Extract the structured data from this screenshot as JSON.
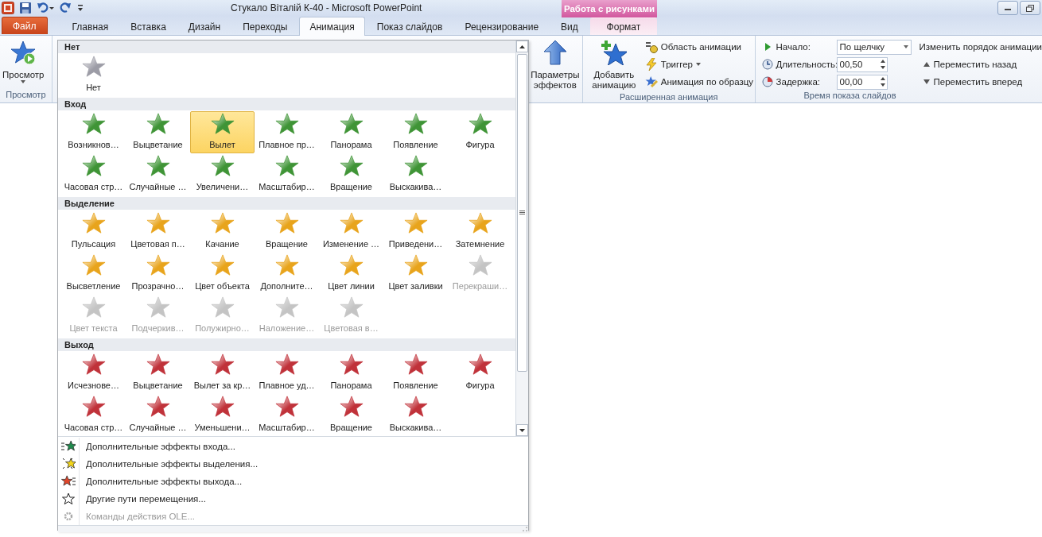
{
  "window": {
    "title": "Стукало Віталій К-40  -  Microsoft PowerPoint",
    "contextual_group": "Работа с рисунками"
  },
  "tabs": [
    {
      "label": "Файл",
      "kind": "file",
      "selected": false
    },
    {
      "label": "Главная",
      "kind": "normal",
      "selected": false
    },
    {
      "label": "Вставка",
      "kind": "normal",
      "selected": false
    },
    {
      "label": "Дизайн",
      "kind": "normal",
      "selected": false
    },
    {
      "label": "Переходы",
      "kind": "normal",
      "selected": false
    },
    {
      "label": "Анимация",
      "kind": "normal",
      "selected": true
    },
    {
      "label": "Показ слайдов",
      "kind": "normal",
      "selected": false
    },
    {
      "label": "Рецензирование",
      "kind": "normal",
      "selected": false
    },
    {
      "label": "Вид",
      "kind": "normal",
      "selected": false
    },
    {
      "label": "Формат",
      "kind": "contextual",
      "selected": false
    }
  ],
  "preview": {
    "button": "Просмотр",
    "group": "Просмотр"
  },
  "effect_options": {
    "label": "Параметры эффектов"
  },
  "advanced": {
    "add": "Добавить анимацию",
    "group": "Расширенная анимация",
    "items": [
      {
        "kind": "pane",
        "label": "Область анимации"
      },
      {
        "kind": "trigger",
        "label": "Триггер"
      },
      {
        "kind": "painter",
        "label": "Анимация по образцу"
      }
    ]
  },
  "timing": {
    "start_label": "Начало:",
    "start_value": "По щелчку",
    "duration_label": "Длительность:",
    "duration_value": "00,50",
    "delay_label": "Задержка:",
    "delay_value": "00,00",
    "reorder_title": "Изменить порядок анимации",
    "move_back": "Переместить назад",
    "move_forward": "Переместить вперед",
    "group": "Время показа слайдов"
  },
  "gallery": {
    "sections": [
      {
        "title": "Нет",
        "color": "#9c9ca6",
        "items": [
          {
            "label": "Нет",
            "selected": false,
            "disabled": false
          }
        ]
      },
      {
        "title": "Вход",
        "color": "#3f9436",
        "items": [
          {
            "label": "Возникнов…",
            "selected": false,
            "disabled": false
          },
          {
            "label": "Выцветание",
            "selected": false,
            "disabled": false
          },
          {
            "label": "Вылет",
            "selected": true,
            "disabled": false
          },
          {
            "label": "Плавное пр…",
            "selected": false,
            "disabled": false
          },
          {
            "label": "Панорама",
            "selected": false,
            "disabled": false
          },
          {
            "label": "Появление",
            "selected": false,
            "disabled": false
          },
          {
            "label": "Фигура",
            "selected": false,
            "disabled": false
          },
          {
            "label": "Часовая стр…",
            "selected": false,
            "disabled": false
          },
          {
            "label": "Случайные …",
            "selected": false,
            "disabled": false
          },
          {
            "label": "Увеличени…",
            "selected": false,
            "disabled": false
          },
          {
            "label": "Масштабир…",
            "selected": false,
            "disabled": false
          },
          {
            "label": "Вращение",
            "selected": false,
            "disabled": false
          },
          {
            "label": "Выскакива…",
            "selected": false,
            "disabled": false
          }
        ]
      },
      {
        "title": "Выделение",
        "color": "#e8a41c",
        "items": [
          {
            "label": "Пульсация",
            "selected": false,
            "disabled": false
          },
          {
            "label": "Цветовая п…",
            "selected": false,
            "disabled": false
          },
          {
            "label": "Качание",
            "selected": false,
            "disabled": false
          },
          {
            "label": "Вращение",
            "selected": false,
            "disabled": false
          },
          {
            "label": "Изменение …",
            "selected": false,
            "disabled": false
          },
          {
            "label": "Приведени…",
            "selected": false,
            "disabled": false
          },
          {
            "label": "Затемнение",
            "selected": false,
            "disabled": false
          },
          {
            "label": "Высветление",
            "selected": false,
            "disabled": false
          },
          {
            "label": "Прозрачно…",
            "selected": false,
            "disabled": false
          },
          {
            "label": "Цвет объекта",
            "selected": false,
            "disabled": false
          },
          {
            "label": "Дополните…",
            "selected": false,
            "disabled": false
          },
          {
            "label": "Цвет линии",
            "selected": false,
            "disabled": false
          },
          {
            "label": "Цвет заливки",
            "selected": false,
            "disabled": false
          },
          {
            "label": "Перекраши…",
            "selected": false,
            "disabled": true
          },
          {
            "label": "Цвет текста",
            "selected": false,
            "disabled": true
          },
          {
            "label": "Подчеркив…",
            "selected": false,
            "disabled": true
          },
          {
            "label": "Полужирно…",
            "selected": false,
            "disabled": true
          },
          {
            "label": "Наложение…",
            "selected": false,
            "disabled": true
          },
          {
            "label": "Цветовая в…",
            "selected": false,
            "disabled": true
          }
        ]
      },
      {
        "title": "Выход",
        "color": "#c0323a",
        "items": [
          {
            "label": "Исчезнове…",
            "selected": false,
            "disabled": false
          },
          {
            "label": "Выцветание",
            "selected": false,
            "disabled": false
          },
          {
            "label": "Вылет за кр…",
            "selected": false,
            "disabled": false
          },
          {
            "label": "Плавное уд…",
            "selected": false,
            "disabled": false
          },
          {
            "label": "Панорама",
            "selected": false,
            "disabled": false
          },
          {
            "label": "Появление",
            "selected": false,
            "disabled": false
          },
          {
            "label": "Фигура",
            "selected": false,
            "disabled": false
          },
          {
            "label": "Часовая стр…",
            "selected": false,
            "disabled": false
          },
          {
            "label": "Случайные …",
            "selected": false,
            "disabled": false
          },
          {
            "label": "Уменьшени…",
            "selected": false,
            "disabled": false
          },
          {
            "label": "Масштабир…",
            "selected": false,
            "disabled": false
          },
          {
            "label": "Вращение",
            "selected": false,
            "disabled": false
          },
          {
            "label": "Выскакива…",
            "selected": false,
            "disabled": false
          }
        ]
      }
    ],
    "menu": [
      {
        "kind": "entrance",
        "label": "Дополнительные эффекты входа...",
        "disabled": false
      },
      {
        "kind": "emphasis",
        "label": "Дополнительные эффекты выделения...",
        "disabled": false
      },
      {
        "kind": "exit",
        "label": "Дополнительные эффекты выхода...",
        "disabled": false
      },
      {
        "kind": "path",
        "label": "Другие пути перемещения...",
        "disabled": false
      },
      {
        "kind": "ole",
        "label": "Команды действия OLE...",
        "disabled": true
      }
    ]
  }
}
